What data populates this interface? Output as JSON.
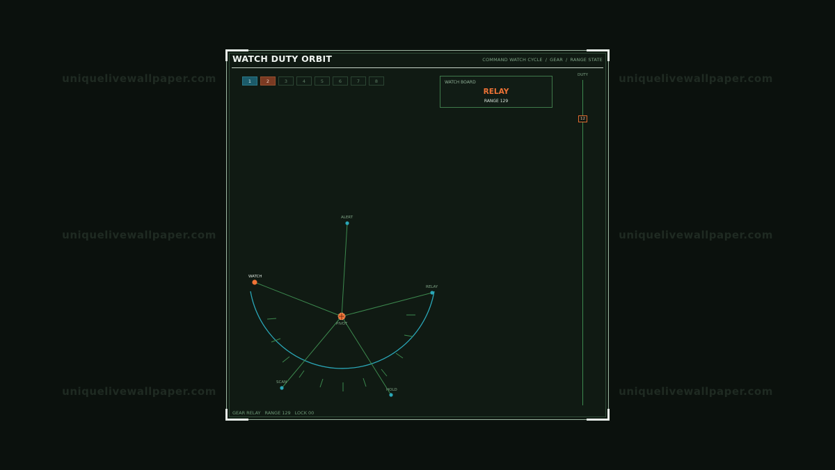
{
  "watermark": "uniquelivewallpaper.com",
  "window": {
    "title": "WATCH DUTY ORBIT",
    "breadcrumb": [
      "COMMAND WATCH CYCLE",
      "GEAR",
      "RANGE STATE"
    ]
  },
  "tabs": [
    "1",
    "2",
    "3",
    "4",
    "5",
    "6",
    "7",
    "8"
  ],
  "board": {
    "label": "WATCH BOARD",
    "value": "RELAY",
    "sub": "RANGE 129"
  },
  "duty": {
    "label": "DUTY",
    "value": "12"
  },
  "orbit": {
    "pivot": "PIVOT",
    "nodes": {
      "alert": "ALERT",
      "watch": "WATCH",
      "relay": "RELAY",
      "scan": "SCAN",
      "hold": "HOLD"
    }
  },
  "status": {
    "gear": "GEAR RELAY",
    "range": "RANGE 129",
    "lock": "LOCK 00"
  },
  "colors": {
    "accent": "#ef7336",
    "cyan": "#2aa7b8",
    "line": "#3d8a4f"
  }
}
